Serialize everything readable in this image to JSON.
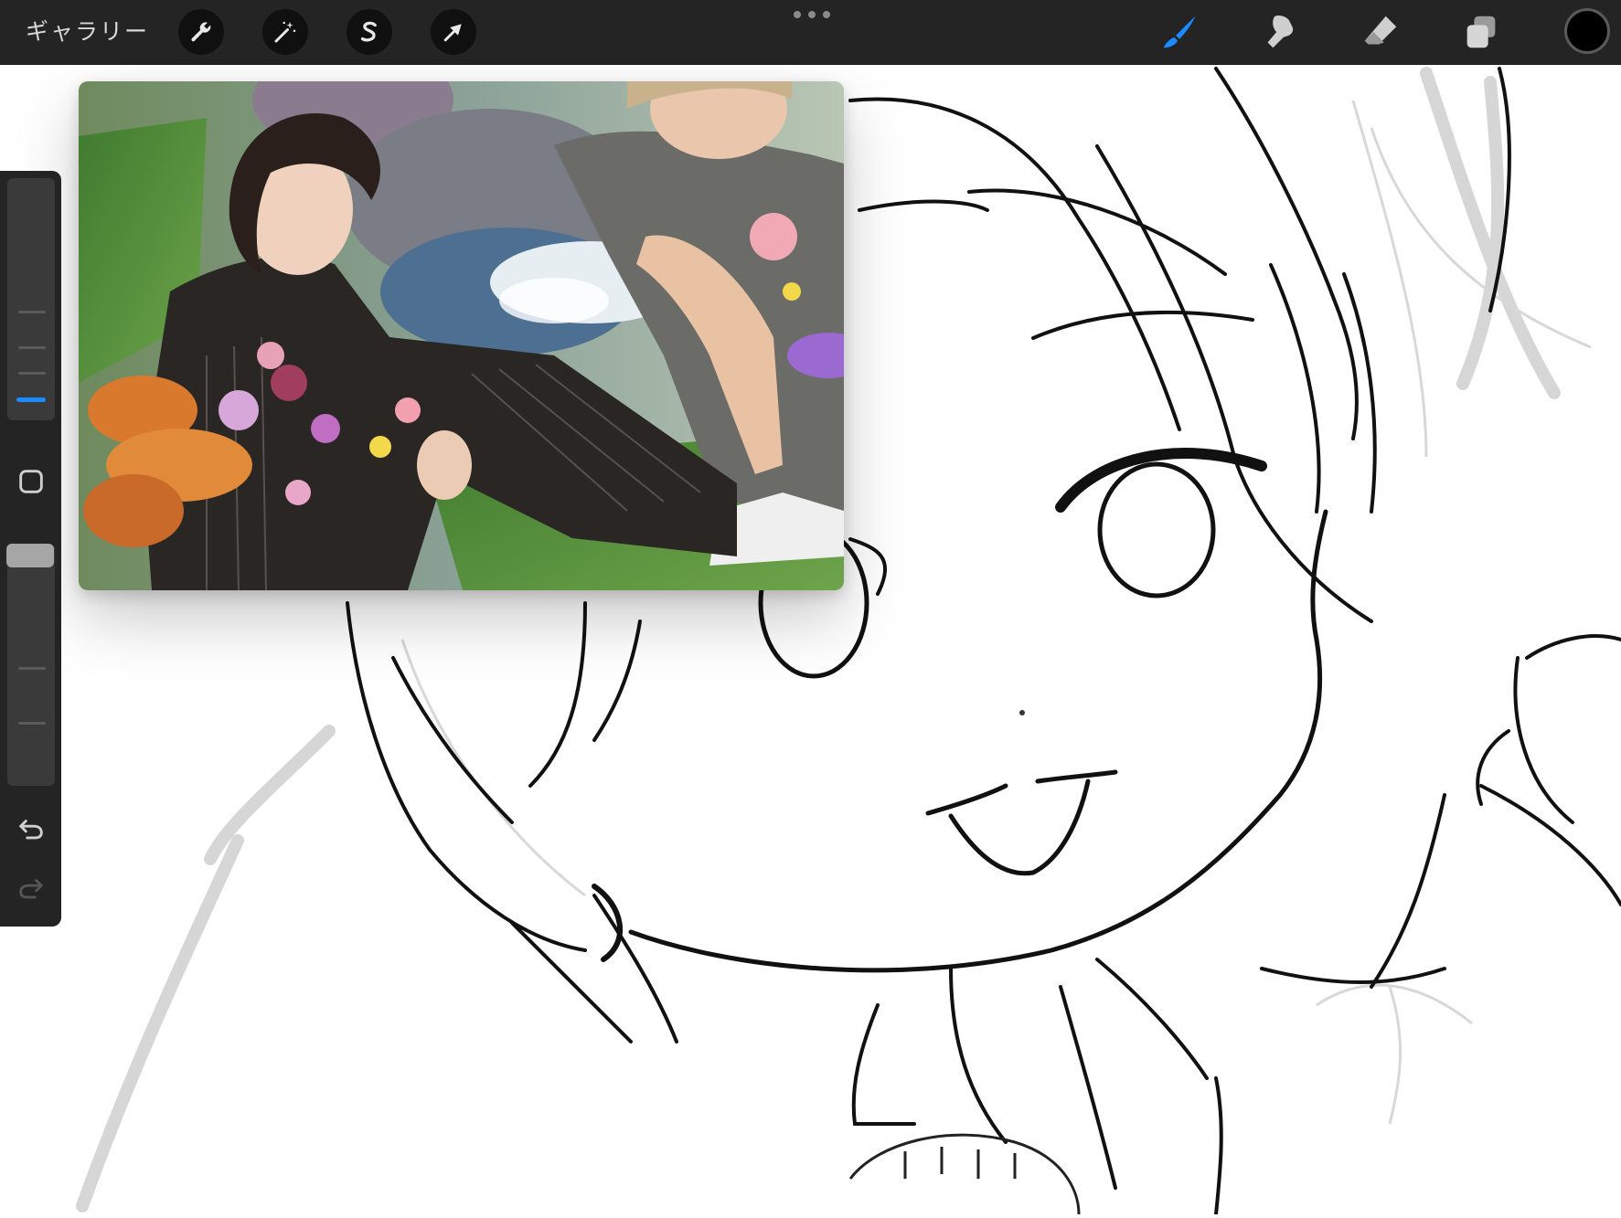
{
  "toolbar": {
    "gallery_label": "ギャラリー",
    "left_tools": [
      {
        "name": "actions",
        "icon": "wrench-icon"
      },
      {
        "name": "adjustments",
        "icon": "magic-wand-icon"
      },
      {
        "name": "selection",
        "icon": "selection-s-icon"
      },
      {
        "name": "transform",
        "icon": "arrow-cursor-icon"
      }
    ],
    "right_tools": [
      {
        "name": "brush",
        "icon": "brush-icon",
        "active": true
      },
      {
        "name": "smudge",
        "icon": "smudge-icon",
        "active": false
      },
      {
        "name": "eraser",
        "icon": "eraser-icon",
        "active": false
      },
      {
        "name": "layers",
        "icon": "layers-icon",
        "active": false
      }
    ],
    "current_color": "#000000",
    "accent_color": "#1a8cff"
  },
  "sidebar": {
    "brush_size_level": 0.25,
    "opacity_level": 0.95,
    "modify_button_icon": "square-icon",
    "undo_icon": "undo-icon",
    "redo_icon": "redo-icon"
  },
  "reference_window": {
    "content": "reference-photo"
  }
}
